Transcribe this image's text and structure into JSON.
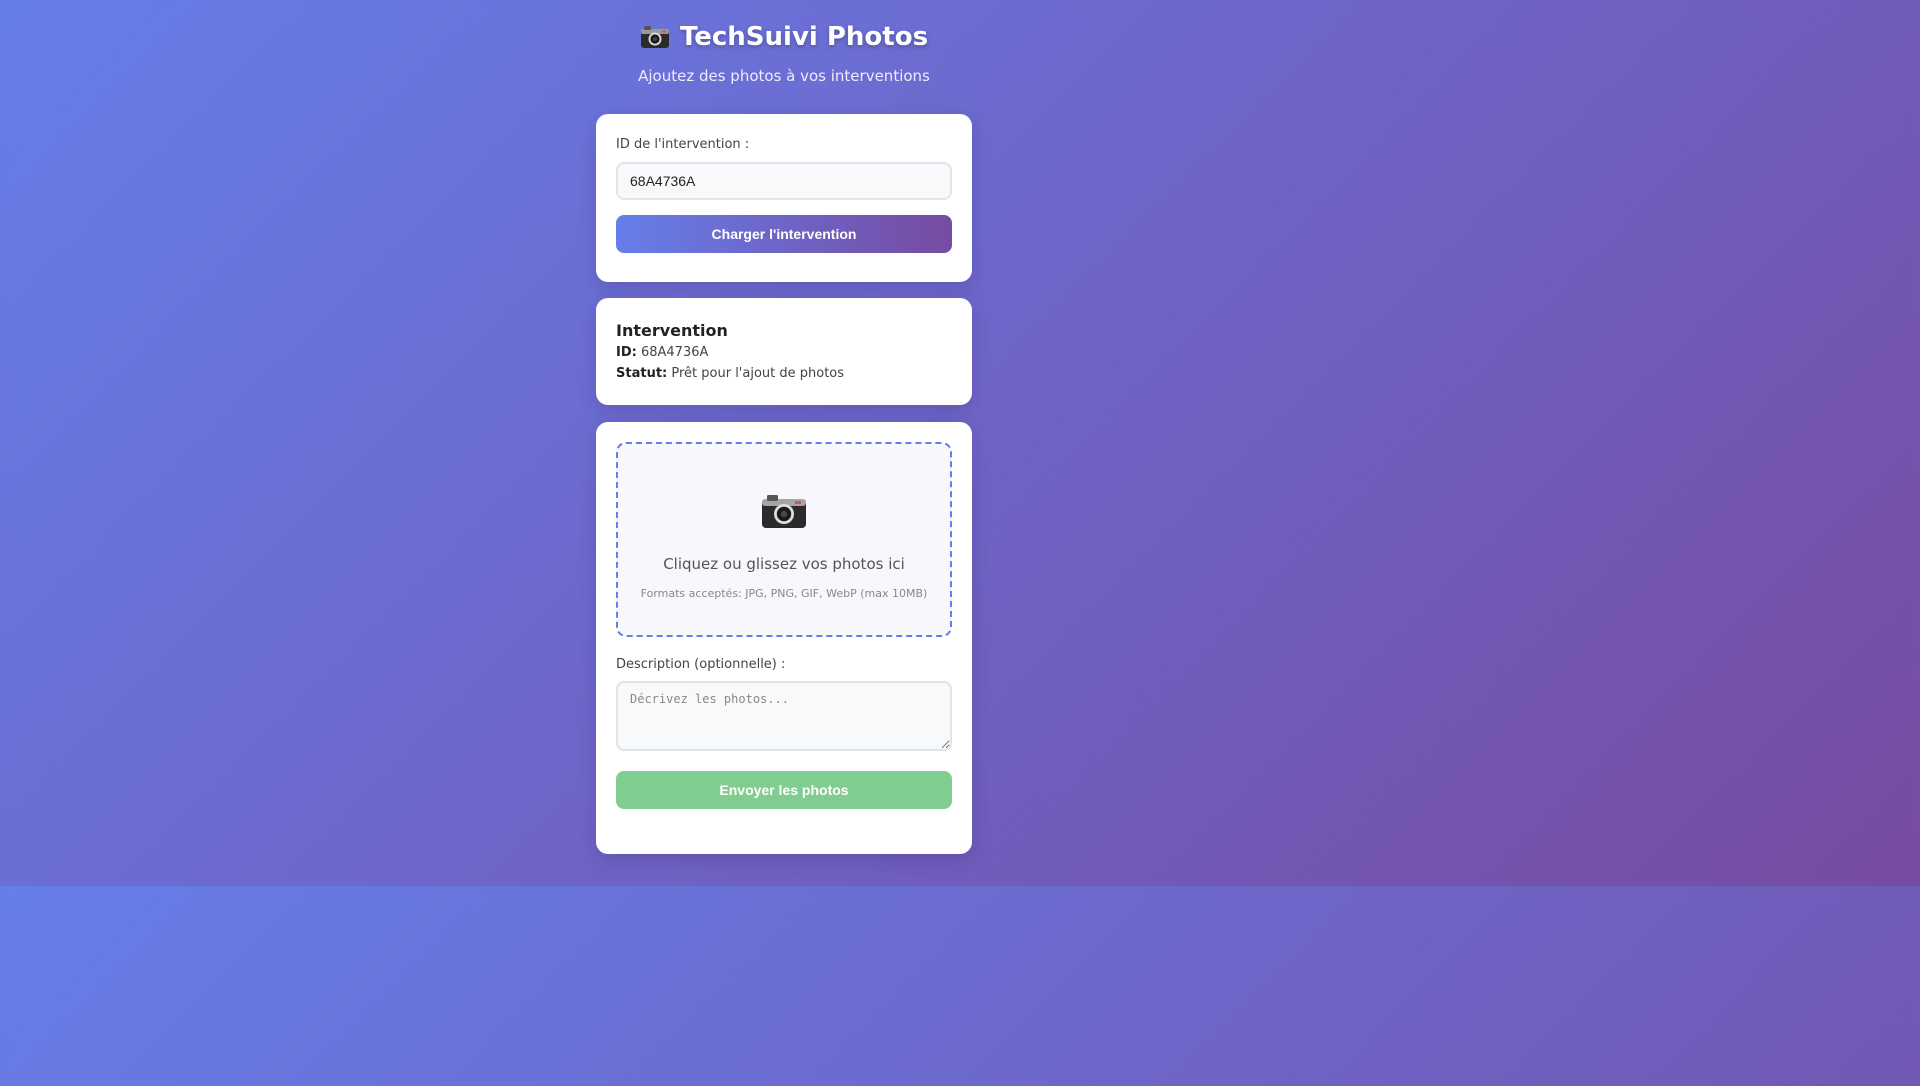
{
  "header": {
    "title": "TechSuivi Photos",
    "subtitle": "Ajoutez des photos à vos interventions",
    "icon": "camera-icon"
  },
  "load_form": {
    "label": "ID de l'intervention :",
    "id_value": "68A4736A",
    "button_label": "Charger l'intervention"
  },
  "intervention": {
    "title": "Intervention",
    "id_label": "ID:",
    "id_value": "68A4736A",
    "status_label": "Statut:",
    "status_value": "Prêt pour l'ajout de photos"
  },
  "upload": {
    "icon": "camera-icon",
    "drop_text": "Cliquez ou glissez vos photos ici",
    "formats_text": "Formats acceptés: JPG, PNG, GIF, WebP (max 10MB)",
    "description_label": "Description (optionnelle) :",
    "description_placeholder": "Décrivez les photos...",
    "description_value": "",
    "send_button_label": "Envoyer les photos"
  },
  "colors": {
    "gradient_start": "#667eea",
    "gradient_end": "#764ba2",
    "send_button": "#81cc8f",
    "dropzone_border": "#667eea"
  }
}
